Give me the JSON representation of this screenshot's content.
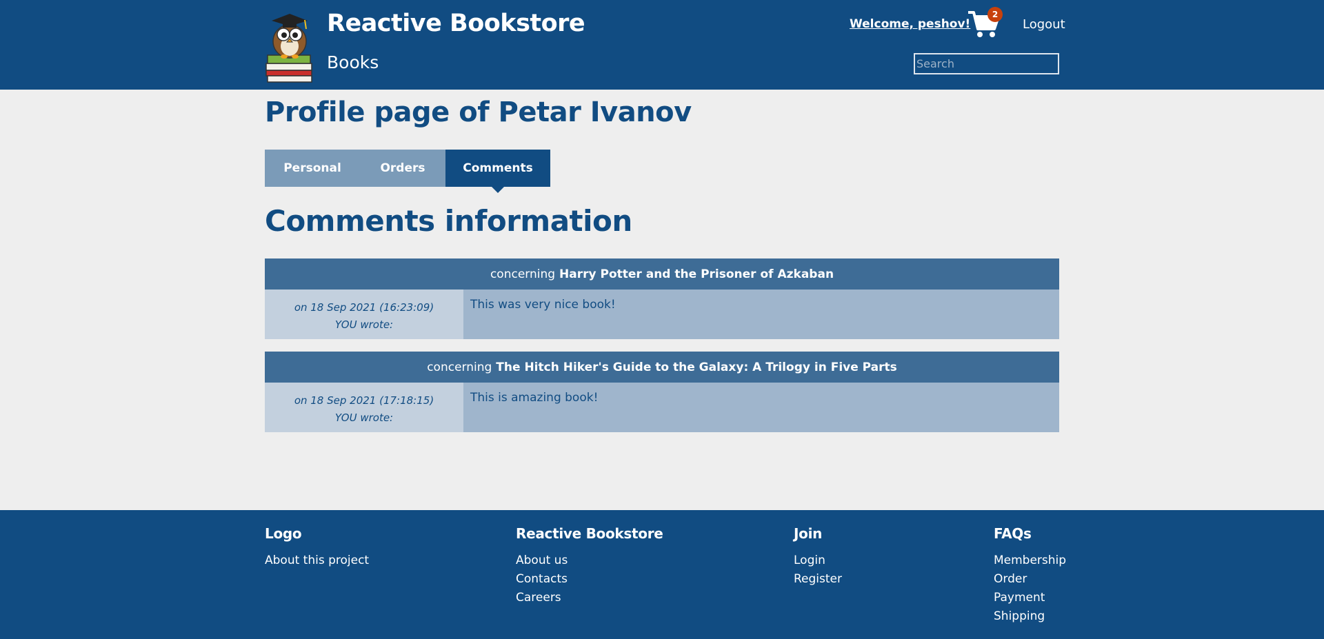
{
  "header": {
    "brand": "Reactive Bookstore",
    "nav_books": "Books",
    "welcome": "Welcome, peshov!",
    "cart_count": "2",
    "logout": "Logout",
    "search_placeholder": "Search"
  },
  "profile": {
    "title": "Profile page of Petar Ivanov",
    "tabs": [
      {
        "label": "Personal"
      },
      {
        "label": "Orders"
      },
      {
        "label": "Comments",
        "active": true
      }
    ],
    "section_title": "Comments information"
  },
  "comments": [
    {
      "prefix": "concerning",
      "book": "Harry Potter and the Prisoner of Azkaban",
      "date": "on 18 Sep 2021 (16:23:09)",
      "author": "YOU wrote:",
      "text": "This was very nice book!"
    },
    {
      "prefix": "concerning",
      "book": "The Hitch Hiker's Guide to the Galaxy: A Trilogy in Five Parts",
      "date": "on 18 Sep 2021 (17:18:15)",
      "author": "YOU wrote:",
      "text": "This is amazing book!"
    }
  ],
  "footer": {
    "columns": [
      {
        "title": "Logo",
        "links": [
          "About this project"
        ]
      },
      {
        "title": "Reactive Bookstore",
        "links": [
          "About us",
          "Contacts",
          "Careers"
        ]
      },
      {
        "title": "Join",
        "links": [
          "Login",
          "Register"
        ]
      },
      {
        "title": "FAQs",
        "links": [
          "Membership",
          "Order",
          "Payment",
          "Shipping"
        ]
      }
    ]
  },
  "colors": {
    "primary": "#114c82",
    "tab_inactive": "#7b9bb8",
    "comment_header": "#3e6c96",
    "badge": "#c7410c"
  }
}
